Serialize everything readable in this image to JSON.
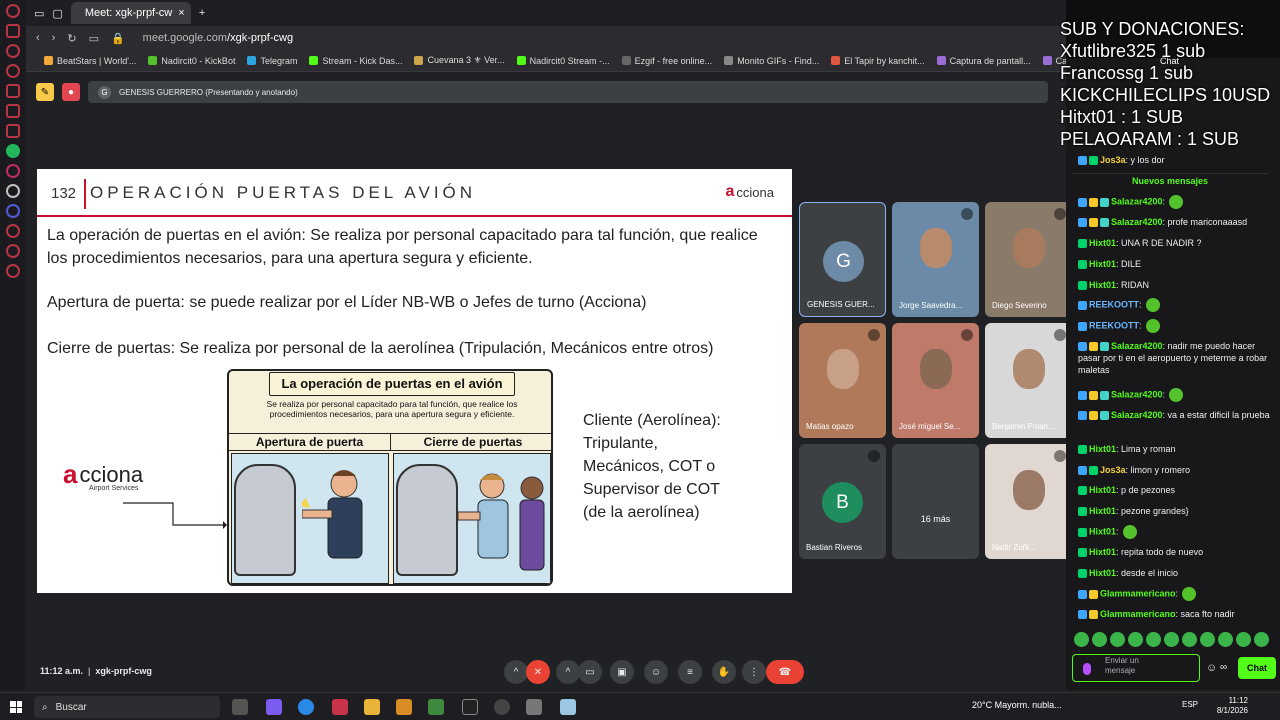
{
  "browser": {
    "tab_title": "Meet: xgk-prpf-cw",
    "url_host": "meet.google.com",
    "url_path": "/xgk-prpf-cwg",
    "bookmarks": [
      "BeatStars | World'...",
      "Nadircit0 - KickBot",
      "Telegram",
      "Stream - Kick Das...",
      "Cuevana 3 ⚜ Ver...",
      "Nadircit0 Stream -...",
      "Ezgif - free online...",
      "Monito GIFs - Find...",
      "El Tapir by kanchit...",
      "Captura de pantall...",
      "Captura d"
    ]
  },
  "meet": {
    "presenter_initial": "G",
    "presenter_label": "GENESIS GUERRERO (Presentando y anotando)",
    "time": "11:12 a.m.",
    "meeting_code": "xgk-prpf-cwg"
  },
  "slide": {
    "number": "132",
    "title": "OPERACIÓN PUERTAS DEL AVIÓN",
    "logo_text": "cciona",
    "logo_letter": "a",
    "para1": "La operación de puertas en el avión: Se realiza por personal capacitado para tal función, que realice los procedimientos necesarios, para una apertura segura y eficiente.",
    "para2": "Apertura de puerta: se puede realizar por el Líder NB-WB o Jefes de turno (Acciona)",
    "para3": "Cierre de puertas: Se realiza por personal de la aerolínea (Tripulación, Mecánicos entre otros)",
    "comic_title": "La operación de puertas en el avión",
    "comic_subtitle": "Se realiza por personal capacitado para tal función, que realice los procedimientos necesarios, para una apertura segura y eficiente.",
    "col_left": "Apertura de puerta",
    "col_right": "Cierre de puertas",
    "acciona_word": "cciona",
    "acciona_sub": "Airport Services",
    "client_lines": [
      "Cliente (Aerolínea):",
      "Tripulante,",
      "Mecánicos, COT o",
      "Supervisor de COT",
      "(de la aerolínea)"
    ]
  },
  "participants": [
    {
      "name": "GENESIS GUER...",
      "initial": "G",
      "color": "#6d8aa6"
    },
    {
      "name": "Jorge Saavedra..."
    },
    {
      "name": "Diego Severino"
    },
    {
      "name": "Matias opazo"
    },
    {
      "name": "José miguel Se..."
    },
    {
      "name": "Benjamin Polan..."
    },
    {
      "name": "Bastian Riveros",
      "initial": "B",
      "color": "#1e8e5e"
    },
    {
      "name": "16 más"
    },
    {
      "name": "Nadir Zuñi..."
    }
  ],
  "overlay": {
    "lines": [
      "SUB Y DONACIONES:",
      "Xfutlibre325 1 sub",
      "Francossg 1 sub",
      "KICKCHILECLIPS 10USD",
      "Hitxt01 : 1 SUB",
      "PELAOARAM : 1 SUB"
    ]
  },
  "chat": {
    "title": "Chat",
    "new_messages": "Nuevos mensajes",
    "messages": [
      {
        "user": "Jos3a",
        "text": ": y los dor",
        "color": "y"
      },
      {
        "user": "Salazar4200",
        "text": ":",
        "color": "g",
        "emote": true
      },
      {
        "user": "Salazar4200",
        "text": ": profe mariconaaasd",
        "color": "g"
      },
      {
        "user": "Hixt01",
        "text": ": UNA R DE NADIR ?",
        "color": "g"
      },
      {
        "user": "Hixt01",
        "text": ": DILE",
        "color": "g"
      },
      {
        "user": "Hixt01",
        "text": ": RIDAN",
        "color": "g"
      },
      {
        "user": "REEKOOTT",
        "text": ":",
        "color": "b",
        "emote": true
      },
      {
        "user": "REEKOOTT",
        "text": ":",
        "color": "b",
        "emote": true
      },
      {
        "user": "Salazar4200",
        "text": ": nadir me puedo hacer pasar por ti en el aeropuerto y meterme a robar maletas",
        "color": "g"
      },
      {
        "user": "Salazar4200",
        "text": ":",
        "color": "g",
        "emote": true
      },
      {
        "user": "Salazar4200",
        "text": ": va a estar dificil la prueba",
        "color": "g"
      },
      {
        "user": "Hixt01",
        "text": ": Lima y roman",
        "color": "g"
      },
      {
        "user": "Jos3a",
        "text": ": limon y romero",
        "color": "y"
      },
      {
        "user": "Hixt01",
        "text": ": p de pezones",
        "color": "g"
      },
      {
        "user": "Hixt01",
        "text": ": pezone grandes}",
        "color": "g"
      },
      {
        "user": "Hixt01",
        "text": ":",
        "color": "g",
        "emote": true
      },
      {
        "user": "Hixt01",
        "text": ": repita todo de nuevo",
        "color": "g"
      },
      {
        "user": "Hixt01",
        "text": ": desde el inicio",
        "color": "g"
      },
      {
        "user": "Glammamericano",
        "text": ":",
        "color": "g",
        "emote": true
      },
      {
        "user": "Glammamericano",
        "text": ": saca fto nadir",
        "color": "g"
      }
    ],
    "input_placeholder": "Enviar un mensaje",
    "send_label": "Chat"
  },
  "taskbar": {
    "search": "Buscar",
    "weather": "20°C  Mayorm. nubla...",
    "lang": "ESP",
    "time": "11:12",
    "date": "8/1/2026"
  }
}
